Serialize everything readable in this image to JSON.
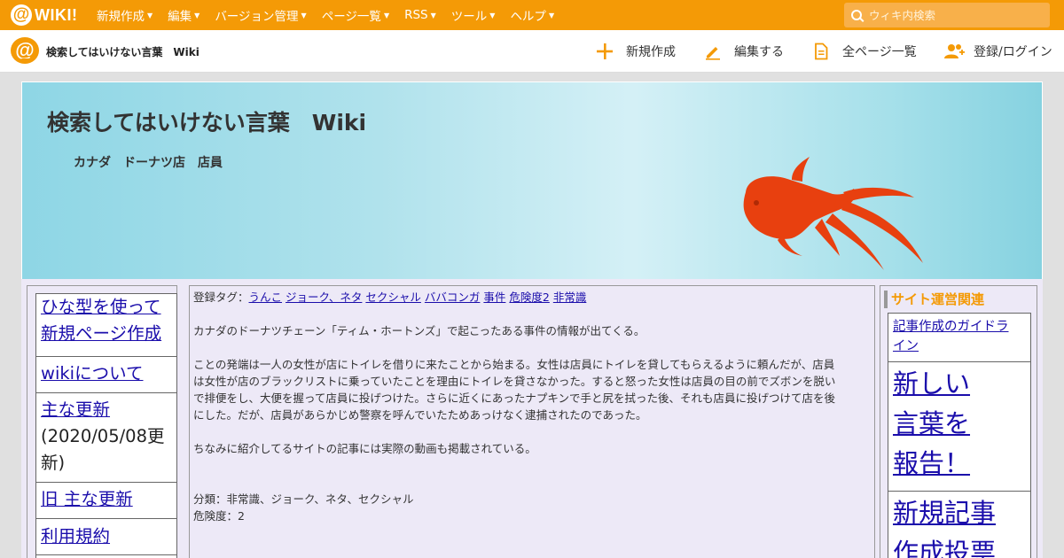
{
  "topbar": {
    "logo_symbol": "@",
    "logo_text": "WIKI!",
    "menu": [
      {
        "label": "新規作成"
      },
      {
        "label": "編集"
      },
      {
        "label": "バージョン管理"
      },
      {
        "label": "ページ一覧"
      },
      {
        "label": "RSS"
      },
      {
        "label": "ツール"
      },
      {
        "label": "ヘルプ"
      }
    ],
    "search_placeholder": "ウィキ内検索"
  },
  "subbar": {
    "logo_symbol": "@",
    "site_name": "検索してはいけない言葉　Wiki",
    "actions": [
      {
        "label": "新規作成",
        "icon": "plus-icon"
      },
      {
        "label": "編集する",
        "icon": "pencil-icon"
      },
      {
        "label": "全ページ一覧",
        "icon": "document-icon"
      },
      {
        "label": "登録/ログイン",
        "icon": "users-icon"
      }
    ]
  },
  "banner": {
    "title": "検索してはいけない言葉　Wiki",
    "subtitle": "カナダ　ドーナツ店　店員"
  },
  "leftnav": {
    "items": [
      {
        "label": "ひな型を使って新規ページ作成",
        "line1": "ひな型を使って",
        "line2": "新規ページ作成"
      },
      {
        "label": "wikiについて"
      },
      {
        "label": "主な更新",
        "note1": "(2020/05/08更",
        "note2": "新)"
      },
      {
        "label": "旧 主な更新"
      },
      {
        "label": "利用規約"
      }
    ]
  },
  "main": {
    "tags_label": "登録タグ：",
    "tags": [
      "うんこ",
      "ジョーク、ネタ",
      "セクシャル",
      "ババコンガ",
      "事件",
      "危険度2",
      "非常識"
    ],
    "para1": "カナダのドーナツチェーン「ティム・ホートンズ」で起こったある事件の情報が出てくる。",
    "para2_lines": [
      "ことの発端は一人の女性が店にトイレを借りに来たことから始まる。女性は店員にトイレを貸してもらえるように頼んだが、店員",
      "は女性が店のブラックリストに乗っていたことを理由にトイレを貸さなかった。すると怒った女性は店員の目の前でズボンを脱い",
      "で排便をし、大便を握って店員に投げつけた。さらに近くにあったナプキンで手と尻を拭った後、それも店員に投げつけて店を後",
      "にした。だが、店員があらかじめ警察を呼んでいたためあっけなく逮捕されたのであった。"
    ],
    "para3": "ちなみに紹介してるサイトの記事には実際の動画も掲載されている。",
    "category": "分類：非常識、ジョーク、ネタ、セクシャル",
    "danger": "危険度：2"
  },
  "rightnav": {
    "title": "サイト運営関連",
    "guide_line1": "記事作成のガイドラ",
    "guide_line2": "イン",
    "report_lines": [
      "新しい ",
      "言葉を ",
      "報告！"
    ],
    "vote_lines": [
      "新規記事",
      "作成投票"
    ]
  },
  "colors": {
    "accent": "#f49a06",
    "link": "#1a0dab",
    "content_bg": "#ede9f7",
    "fish": "#e8400f"
  }
}
